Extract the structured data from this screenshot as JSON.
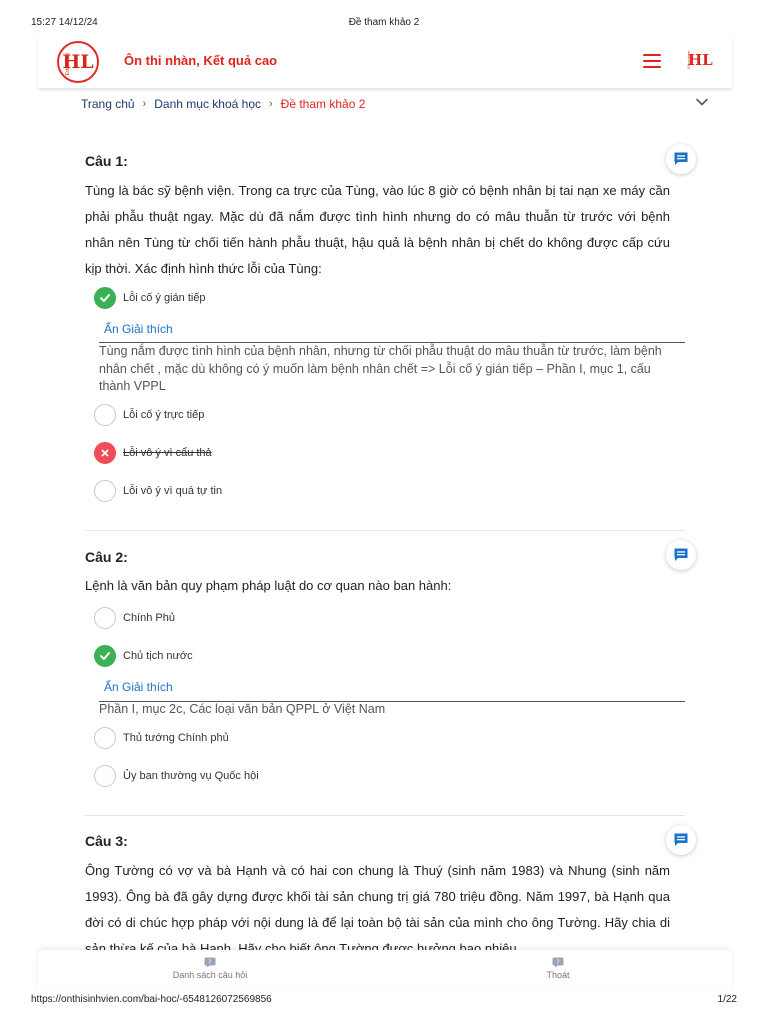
{
  "print": {
    "timestamp": "15:27 14/12/24",
    "doc_title": "Đề tham khảo 2",
    "url": "https://onthisinhvien.com/bai-hoc/-6548126072569856",
    "page": "1/22"
  },
  "header": {
    "logo_text": "HL",
    "logo_tiny": "Education",
    "slogan": "Ôn thi nhàn, Kết quả cao"
  },
  "breadcrumb": {
    "items": [
      "Trang chủ",
      "Danh mục khoá học",
      "Đề tham khảo 2"
    ]
  },
  "colors": {
    "brand": "#e0241c",
    "link": "#1a73c8",
    "correct": "#3cb054",
    "wrong": "#ef4d57",
    "comment_icon": "#1a73c8"
  },
  "questions": [
    {
      "title": "Câu 1:",
      "text": "Tùng là bác sỹ bệnh viện. Trong ca trực của Tùng, vào lúc 8 giờ có bệnh nhân bị tai nạn xe máy cần phải phẫu thuật ngay. Mặc dù đã nắm được tình hình nhưng do có mâu thuẫn từ trước với bệnh nhân nên Tùng từ chối tiến hành phẫu thuật, hậu quả là bệnh nhân bị chết do không được cấp cứu kịp thời. Xác định hình thức lỗi của Tùng:",
      "options": [
        {
          "label": "Lỗi cố ý gián tiếp",
          "state": "correct"
        },
        {
          "label": "Lỗi cố ý trực tiếp",
          "state": "none"
        },
        {
          "label": "Lỗi vô ý vì cẩu thả",
          "state": "wrong"
        },
        {
          "label": "Lỗi vô ý vì quá tự tin",
          "state": "none"
        }
      ],
      "explanation_toggle": "Ẩn Giải thích",
      "explanation": "Tùng nắm được tình hình của bệnh nhân, nhưng từ chối phẫu thuật do mâu thuẫn từ trước, làm bệnh nhân chết , mặc dù không có ý muốn làm bệnh nhân chết => Lỗi cố ý gián tiếp – Phần I, mục 1, cấu thành VPPL"
    },
    {
      "title": "Câu 2:",
      "text": "Lệnh là văn bản quy phạm pháp luật do cơ quan nào ban hành:",
      "options": [
        {
          "label": "Chính Phủ",
          "state": "none"
        },
        {
          "label": "Chủ tịch nước",
          "state": "correct"
        },
        {
          "label": "Thủ tướng Chính phủ",
          "state": "none"
        },
        {
          "label": "Ủy ban thường vụ Quốc hội",
          "state": "none"
        }
      ],
      "explanation_toggle": "Ẩn Giải thích",
      "explanation": "Phần I, mục 2c, Các loại văn bản QPPL ở Việt Nam"
    },
    {
      "title": "Câu 3:",
      "text": "Ông Tường có vợ và bà Hạnh và có hai con chung là Thuý (sinh năm 1983) và Nhung (sinh năm 1993). Ông bà đã gây dựng được khối tài sản chung trị giá 780 triệu đồng. Năm 1997, bà Hạnh qua đời có di chúc hợp pháp với nội dung là để lại toàn bộ tài sản của mình cho ông Tường. Hãy chia di sản thừa kế của bà Hạnh. Hãy cho biết ông Tường được hưởng bao nhiêu"
    }
  ],
  "bottom_nav": {
    "question_list": "Danh sách câu hỏi",
    "exit": "Thoát"
  }
}
